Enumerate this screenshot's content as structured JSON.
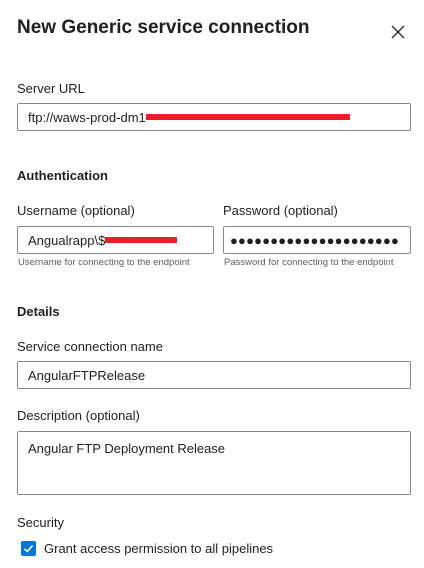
{
  "panel": {
    "title": "New Generic service connection",
    "close_icon": "close-icon"
  },
  "server_url": {
    "label": "Server URL",
    "value": "ftp://waws-prod-dm1"
  },
  "authentication": {
    "heading": "Authentication",
    "username": {
      "label": "Username (optional)",
      "value": "Angualrapp\\$",
      "hint": "Username for connecting to the endpoint"
    },
    "password": {
      "label": "Password (optional)",
      "value": "●●●●●●●●●●●●●●●●●●●●●",
      "hint": "Password for connecting to the endpoint"
    }
  },
  "details": {
    "heading": "Details",
    "name": {
      "label": "Service connection name",
      "value": "AngularFTPRelease"
    },
    "description": {
      "label": "Description (optional)",
      "value": "Angular FTP Deployment Release"
    }
  },
  "security": {
    "heading": "Security",
    "grant_access": {
      "label": "Grant access permission to all pipelines",
      "checked": true
    }
  },
  "colors": {
    "accent": "#0078d4",
    "redaction": "#e8202a",
    "border": "#8a8886",
    "hint_text": "#605e5c"
  }
}
